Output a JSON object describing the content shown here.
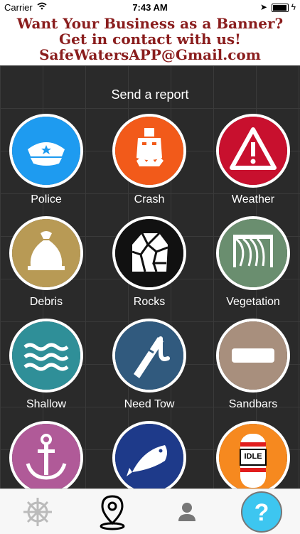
{
  "status_bar": {
    "carrier": "Carrier",
    "time": "7:43 AM"
  },
  "banner": {
    "line1": "Want Your Business as a Banner?",
    "line2": "Get in contact with us!",
    "line3": "SafeWatersAPP@Gmail.com"
  },
  "title": "Send a report",
  "reports": [
    {
      "label": "Police",
      "icon": "police-cap-icon",
      "color": "#1e9bf0"
    },
    {
      "label": "Crash",
      "icon": "ship-crash-icon",
      "color": "#f25a1a"
    },
    {
      "label": "Weather",
      "icon": "warning-icon",
      "color": "#c8102e"
    },
    {
      "label": "Debris",
      "icon": "debris-bag-icon",
      "color": "#b89a55"
    },
    {
      "label": "Rocks",
      "icon": "rocks-icon",
      "color": "#111111"
    },
    {
      "label": "Vegetation",
      "icon": "vegetation-icon",
      "color": "#6a8e6f"
    },
    {
      "label": "Shallow",
      "icon": "waves-icon",
      "color": "#2f8f98"
    },
    {
      "label": "Need Tow",
      "icon": "tow-hook-icon",
      "color": "#315a7e"
    },
    {
      "label": "Sandbars",
      "icon": "sandbar-icon",
      "color": "#a88f7d"
    },
    {
      "label": "",
      "icon": "anchor-icon",
      "color": "#b05a98"
    },
    {
      "label": "",
      "icon": "fish-icon",
      "color": "#1e3a8a"
    },
    {
      "label": "",
      "icon": "idle-buoy-icon",
      "color": "#f6891f"
    }
  ],
  "idle_text": "IDLE",
  "tabs": [
    {
      "icon": "ship-wheel-icon"
    },
    {
      "icon": "map-pin-icon"
    },
    {
      "icon": "person-icon"
    },
    {
      "icon": "help-icon"
    }
  ]
}
